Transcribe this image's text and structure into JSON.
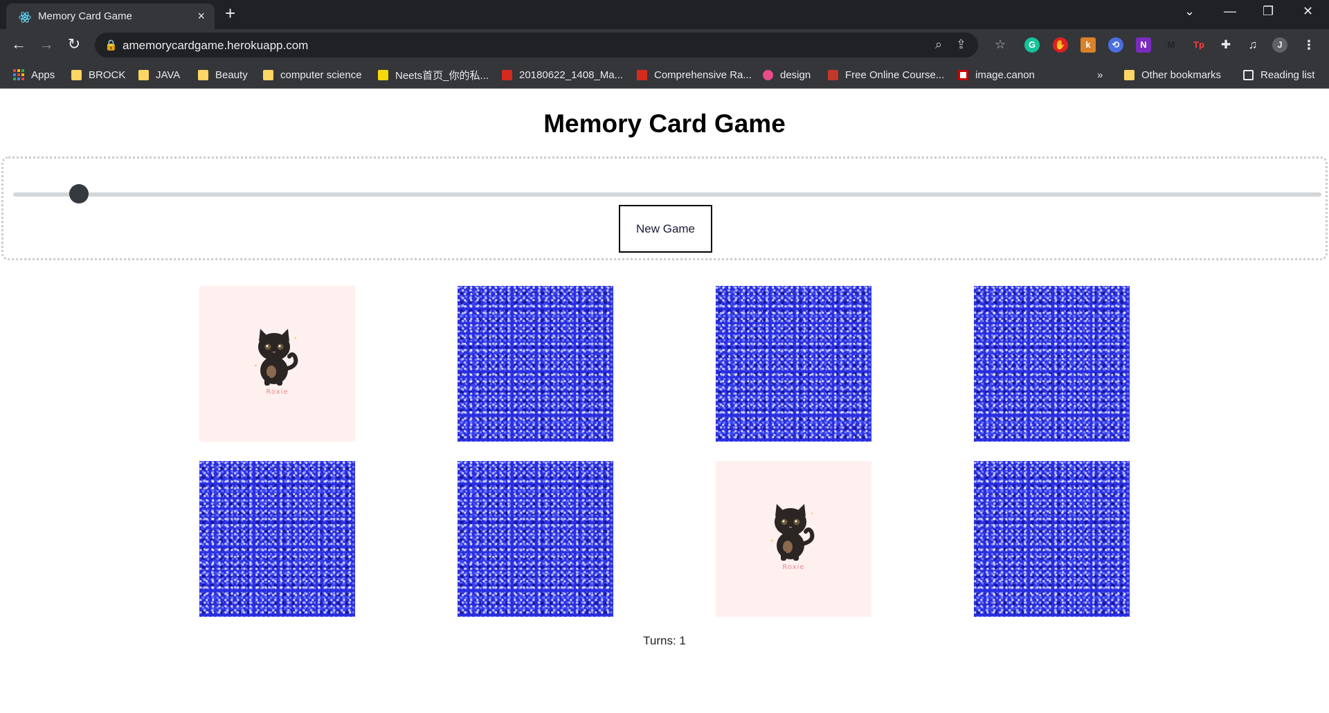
{
  "browser": {
    "tab_title": "Memory Card Game",
    "url": "amemorycardgame.herokuapp.com",
    "close_icon": "×",
    "new_tab_icon": "+",
    "bookmarks": [
      {
        "label": "Apps",
        "icon": "apps-grid-icon"
      },
      {
        "label": "BROCK",
        "icon": "folder-icon"
      },
      {
        "label": "JAVA",
        "icon": "folder-icon"
      },
      {
        "label": "Beauty",
        "icon": "folder-icon"
      },
      {
        "label": "computer science",
        "icon": "folder-icon"
      },
      {
        "label": "Neets首页_你的私...",
        "icon": "site-icon"
      },
      {
        "label": "20180622_1408_Ma...",
        "icon": "maple-leaf-icon"
      },
      {
        "label": "Comprehensive Ra...",
        "icon": "maple-leaf-icon"
      },
      {
        "label": "design",
        "icon": "dribbble-icon"
      },
      {
        "label": "Free Online Course...",
        "icon": "site-icon"
      },
      {
        "label": "image.canon",
        "icon": "site-icon"
      }
    ],
    "more_bookmarks": "»",
    "other_bookmarks": "Other bookmarks",
    "reading_list": "Reading list",
    "profile_initial": "J"
  },
  "game": {
    "title": "Memory Card Game",
    "new_game_label": "New Game",
    "slider_value_fraction": 0.05,
    "turns_text": "Turns: 1",
    "cards": [
      {
        "state": "face-up",
        "name": "Roxie"
      },
      {
        "state": "face-down"
      },
      {
        "state": "face-down"
      },
      {
        "state": "face-down"
      },
      {
        "state": "face-down"
      },
      {
        "state": "face-down"
      },
      {
        "state": "face-up",
        "name": "Roxie"
      },
      {
        "state": "face-down"
      }
    ]
  },
  "colors": {
    "card_back": "#2a2ee0",
    "card_front": "#fff0f0",
    "slider_thumb": "#343a40"
  }
}
